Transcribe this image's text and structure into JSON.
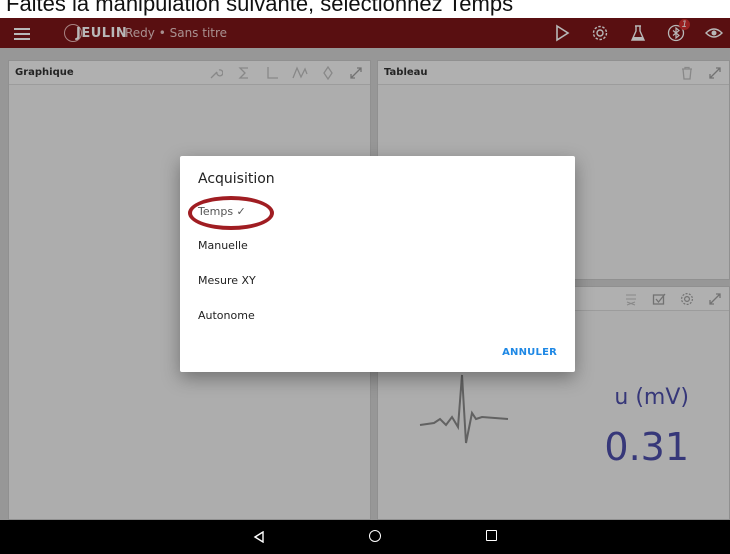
{
  "caption": {
    "text": "Faites la manipulation suivante, selectionnez Temps"
  },
  "appbar": {
    "brand": "JEULIN",
    "subtitle": "Redy • Sans titre",
    "badge_count": "1",
    "icons": [
      "menu-icon",
      "play-icon",
      "gear-icon",
      "flask-icon",
      "bluetooth-icon",
      "eye-icon"
    ]
  },
  "graph_panel": {
    "title": "Graphique",
    "tools": [
      "wrench-icon",
      "sigma-icon",
      "axes-icon",
      "curve-icon",
      "move-icon",
      "expand-icon"
    ]
  },
  "table_panel": {
    "title": "Tableau",
    "tools": [
      "trash-icon",
      "expand-icon"
    ]
  },
  "meter_panel": {
    "unit": "u (mV)",
    "value": "0.31",
    "tools": [
      "sort-icon",
      "checkbox-icon",
      "gear-icon",
      "expand-icon"
    ]
  },
  "dialog": {
    "title": "Acquisition",
    "options": [
      {
        "label": "Temps ✓",
        "selected": true
      },
      {
        "label": "Manuelle",
        "selected": false
      },
      {
        "label": "Mesure XY",
        "selected": false
      },
      {
        "label": "Autonome",
        "selected": false
      }
    ],
    "cancel_label": "ANNULER"
  },
  "colors": {
    "appbar": "#7c1618",
    "highlight": "#a01d22",
    "accent_blue": "#1e88e5",
    "meter_text": "#4b4da8"
  }
}
